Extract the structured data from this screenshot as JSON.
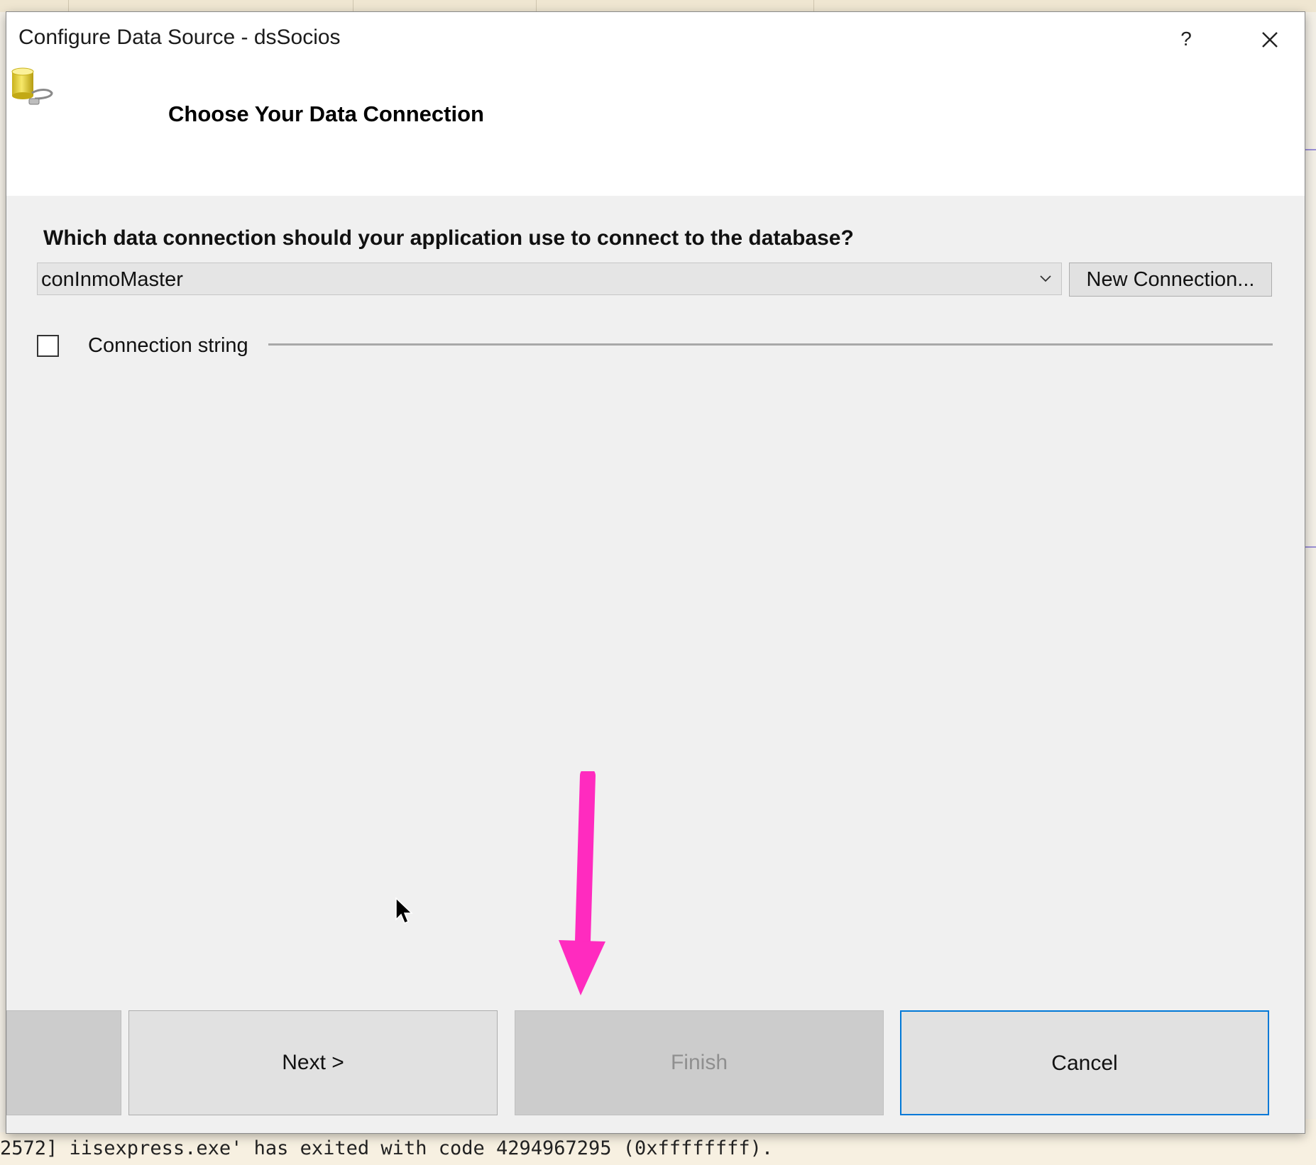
{
  "dialog": {
    "title": "Configure Data Source - dsSocios",
    "help_label": "?",
    "icon": "database-connection-icon"
  },
  "header": {
    "title": "Choose Your Data Connection"
  },
  "connection": {
    "question": "Which data connection should your application use to connect to the database?",
    "selected": "conInmoMaster",
    "new_connection_label": "New Connection...",
    "connection_string_label": "Connection string",
    "connection_string_checked": false
  },
  "buttons": {
    "next": "Next >",
    "finish": "Finish",
    "cancel": "Cancel"
  },
  "background": {
    "output_line": "2572] iisexpress.exe' has exited with code 4294967295 (0xffffffff)."
  },
  "colors": {
    "annotation_arrow": "#ff2bbf",
    "focus_border": "#0078d7"
  }
}
